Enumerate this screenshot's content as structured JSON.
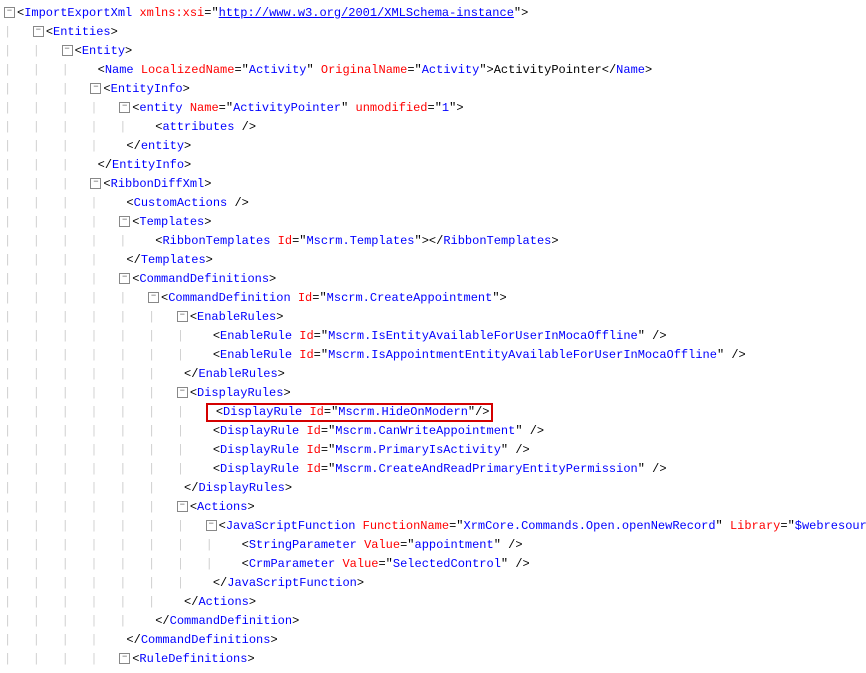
{
  "xml": {
    "xmlns_attr": "xmlns:xsi",
    "xmlns_val": "http://www.w3.org/2001/XMLSchema-instance",
    "root_open": "ImportExportXml",
    "entities": "Entities",
    "entity": "Entity",
    "name_tag": "Name",
    "name_localized_attr": "LocalizedName",
    "name_localized_val": "Activity",
    "name_original_attr": "OriginalName",
    "name_original_val": "Activity",
    "name_text": "ActivityPointer",
    "entityinfo": "EntityInfo",
    "entity_lc": "entity",
    "entity_name_attr": "Name",
    "entity_name_val": "ActivityPointer",
    "entity_unmod_attr": "unmodified",
    "entity_unmod_val": "1",
    "attributes": "attributes",
    "ribbondiff": "RibbonDiffXml",
    "customactions": "CustomActions",
    "templates": "Templates",
    "ribbontemplates": "RibbonTemplates",
    "id_attr": "Id",
    "ribbontemplates_id": "Mscrm.Templates",
    "commanddefs": "CommandDefinitions",
    "commanddef": "CommandDefinition",
    "commanddef_id": "Mscrm.CreateAppointment",
    "enablerules": "EnableRules",
    "enablerule": "EnableRule",
    "enablerule1_id": "Mscrm.IsEntityAvailableForUserInMocaOffline",
    "enablerule2_id": "Mscrm.IsAppointmentEntityAvailableForUserInMocaOffline",
    "displayrules": "DisplayRules",
    "displayrule": "DisplayRule",
    "displayrule1_id": "Mscrm.HideOnModern",
    "displayrule2_id": "Mscrm.CanWriteAppointment",
    "displayrule3_id": "Mscrm.PrimaryIsActivity",
    "displayrule4_id": "Mscrm.CreateAndReadPrimaryEntityPermission",
    "actions": "Actions",
    "jsfunc": "JavaScriptFunction",
    "funcname_attr": "FunctionName",
    "funcname_val": "XrmCore.Commands.Open.openNewRecord",
    "library_attr": "Library",
    "library_val": "$webresource:Main_system_library.js",
    "stringparam": "StringParameter",
    "value_attr": "Value",
    "stringparam_val": "appointment",
    "crmparam": "CrmParameter",
    "crmparam_val": "SelectedControl",
    "ruledefs": "RuleDefinitions"
  }
}
